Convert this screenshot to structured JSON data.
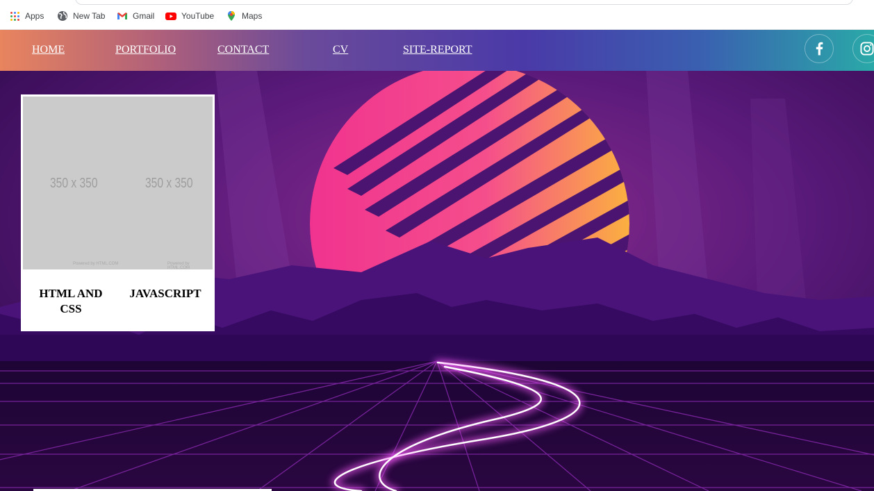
{
  "bookmarks": [
    {
      "label": "Apps",
      "icon": "apps-grid-icon"
    },
    {
      "label": "New Tab",
      "icon": "globe-icon"
    },
    {
      "label": "Gmail",
      "icon": "gmail-icon"
    },
    {
      "label": "YouTube",
      "icon": "youtube-icon"
    },
    {
      "label": "Maps",
      "icon": "maps-pin-icon"
    }
  ],
  "nav": {
    "links": [
      "HOME",
      "PORTFOLIO",
      "CONTACT",
      "CV",
      "SITE-REPORT"
    ],
    "social_icons": [
      "facebook-icon",
      "instagram-icon"
    ]
  },
  "card": {
    "placeholder_left": "350 x 350",
    "placeholder_right": "350 x 350",
    "placeholder_credit": "Powered by HTML.COM",
    "label_left": "HTML AND CSS",
    "label_right": "JAVASCRIPT"
  },
  "colors": {
    "nav_start": "#e8845e",
    "nav_end": "#2aa9a8",
    "sun_pink": "#f0338f",
    "sun_orange": "#fbb040",
    "mountain": "#3e0a6a",
    "neon": "#ff6cff"
  }
}
